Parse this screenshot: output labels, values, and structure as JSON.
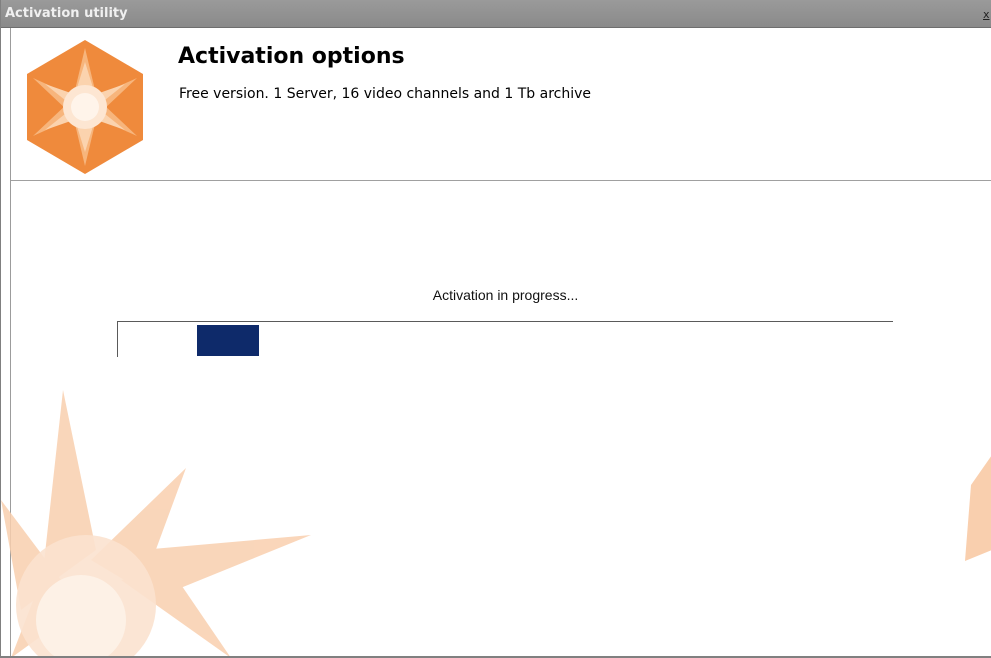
{
  "window": {
    "title": "Activation utility",
    "close_label": "x"
  },
  "header": {
    "title": "Activation options",
    "subtitle": "Free version. 1 Server, 16 video channels and 1 Tb archive",
    "logo_icon": "star-hexagon-logo-icon"
  },
  "main": {
    "status_text": "Activation in progress...",
    "progress_style": "marquee"
  },
  "colors": {
    "brand_orange": "#ef8a3c",
    "progress_fill": "#0e2a6a",
    "titlebar": "#8f8f8f"
  }
}
